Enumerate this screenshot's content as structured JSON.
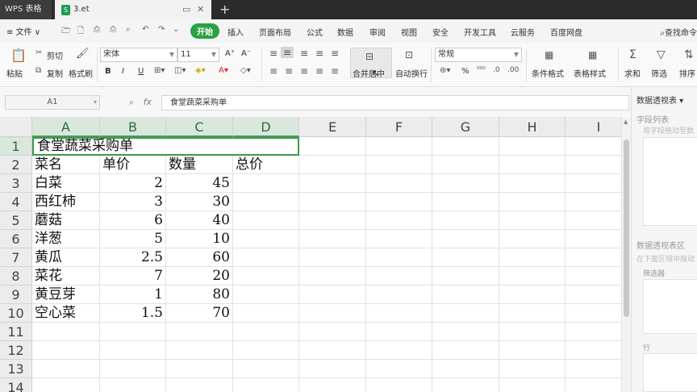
{
  "titlebar": {
    "app_tab": "WPS 表格",
    "file_tab": "3.et",
    "file_icon": "S",
    "add_tab": "+"
  },
  "menubar": {
    "file_menu": "≡ 文件 ∨",
    "tabs": [
      "开始",
      "插入",
      "页面布局",
      "公式",
      "数据",
      "审阅",
      "视图",
      "安全",
      "开发工具",
      "云服务",
      "百度网盘"
    ],
    "active_tab": "开始",
    "search_cmd": "查找命令"
  },
  "ribbon": {
    "paste": "粘贴",
    "cut": "剪切",
    "copy": "复制",
    "format_painter": "格式刷",
    "font_name": "宋体",
    "font_size": "11",
    "bold": "B",
    "italic": "I",
    "underline": "U",
    "grow_font": "A⁺",
    "shrink_font": "A⁻",
    "merge_center": "合并居中",
    "wrap_text": "自动换行",
    "number_format": "常规",
    "percent": "%",
    "conditional_format": "条件格式",
    "table_style": "表格样式",
    "sum": "求和",
    "filter": "筛选",
    "sort": "排序"
  },
  "formula_bar": {
    "name_box": "A1",
    "fx": "fx",
    "formula": "食堂蔬菜采购单"
  },
  "grid": {
    "columns": [
      "A",
      "B",
      "C",
      "D",
      "E",
      "F",
      "G",
      "H",
      "I"
    ],
    "rows": [
      "1",
      "2",
      "3",
      "4",
      "5",
      "6",
      "7",
      "8",
      "9",
      "10",
      "11",
      "12",
      "13",
      "14"
    ],
    "title": "食堂蔬菜采购单",
    "headers": [
      "菜名",
      "单价",
      "数量",
      "总价"
    ],
    "data": [
      [
        "白菜",
        "2",
        "45"
      ],
      [
        "西红柿",
        "3",
        "30"
      ],
      [
        "蘑菇",
        "6",
        "40"
      ],
      [
        "洋葱",
        "5",
        "10"
      ],
      [
        "黄瓜",
        "2.5",
        "60"
      ],
      [
        "菜花",
        "7",
        "20"
      ],
      [
        "黄豆芽",
        "1",
        "80"
      ],
      [
        "空心菜",
        "1.5",
        "70"
      ]
    ]
  },
  "right_panel": {
    "title": "数据透视表 ▾",
    "field_list": "字段列表",
    "field_hint": "将字段拖动至数",
    "areas": "数据透视表区",
    "areas_hint": "在下面区域中拖动",
    "filter": "筛选器",
    "rows": "行"
  },
  "colors": {
    "accent": "#2aa144",
    "selection_border": "#3c9a4f"
  }
}
